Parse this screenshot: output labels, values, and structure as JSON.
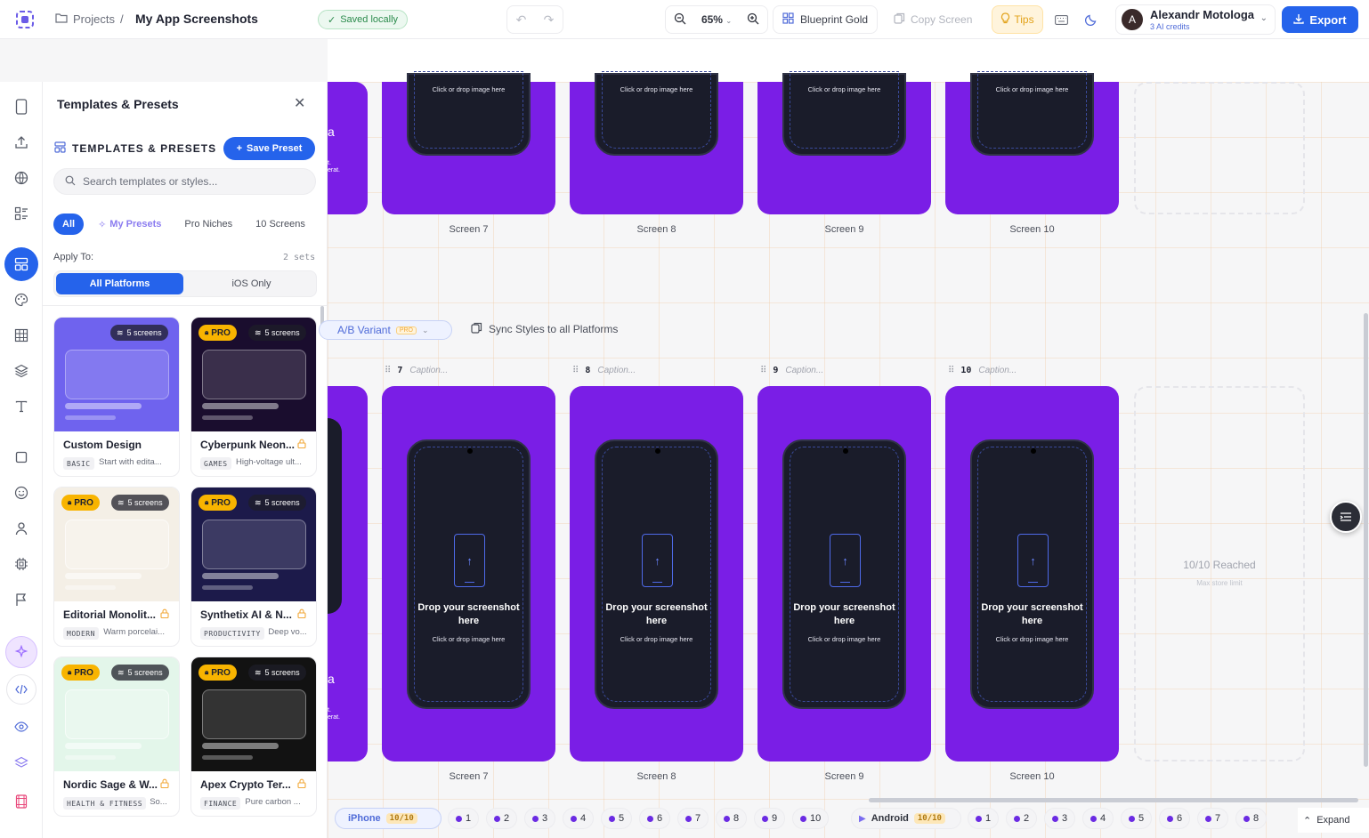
{
  "topbar": {
    "breadcrumb_root": "Projects",
    "breadcrumb_sep": "/",
    "project_title": "My App Screenshots",
    "saved_status": "Saved locally",
    "zoom": "65%",
    "theme_name": "Blueprint Gold",
    "copy_screen": "Copy Screen",
    "tips": "Tips",
    "user_name": "Alexandr Motologa",
    "user_credits": "3 AI credits",
    "user_initial": "A",
    "export": "Export"
  },
  "panel": {
    "title": "Templates & Presets",
    "section_title": "TEMPLATES & PRESETS",
    "save_preset": "Save Preset",
    "search_placeholder": "Search templates or styles...",
    "filters": [
      "All",
      "My Presets",
      "Pro Niches",
      "10 Screens"
    ],
    "apply_label": "Apply To:",
    "apply_count": "2 sets",
    "segment_a": "All Platforms",
    "segment_b": "iOS Only",
    "cards": [
      {
        "name": "Custom Design",
        "tag": "BASIC",
        "desc": "Start with edita...",
        "screens": "5 screens",
        "pro": false,
        "locked": false,
        "bg": "#6f63ee"
      },
      {
        "name": "Cyberpunk Neon...",
        "tag": "GAMES",
        "desc": "High-voltage ult...",
        "screens": "5 screens",
        "pro": true,
        "locked": true,
        "bg": "#1a0d2e"
      },
      {
        "name": "Editorial Monolit...",
        "tag": "MODERN",
        "desc": "Warm porcelai...",
        "screens": "5 screens",
        "pro": true,
        "locked": true,
        "bg": "#f4efe6"
      },
      {
        "name": "Synthetix AI & N...",
        "tag": "PRODUCTIVITY",
        "desc": "Deep vo...",
        "screens": "5 screens",
        "pro": true,
        "locked": true,
        "bg": "#1c1a4a"
      },
      {
        "name": "Nordic Sage & W...",
        "tag": "HEALTH & FITNESS",
        "desc": "So...",
        "screens": "5 screens",
        "pro": true,
        "locked": true,
        "bg": "#e3f6ea"
      },
      {
        "name": "Apex Crypto Ter...",
        "tag": "FINANCE",
        "desc": "Pure carbon ...",
        "screens": "5 screens",
        "pro": true,
        "locked": true,
        "bg": "#121212"
      }
    ],
    "pro_label": "PRO"
  },
  "canvas": {
    "screens_top": [
      "Screen 7",
      "Screen 8",
      "Screen 9",
      "Screen 10"
    ],
    "screens_bottom": [
      "Screen 7",
      "Screen 8",
      "Screen 9",
      "Screen 10"
    ],
    "caption_numbers": [
      "7",
      "8",
      "9",
      "10"
    ],
    "caption_placeholder": "Caption...",
    "drop_title": "Drop your screenshot here",
    "drop_sub": "Click or drop image here",
    "ab_variant": "A/B Variant",
    "ab_pro": "PRO",
    "sync_styles": "Sync Styles to all Platforms",
    "reached": "10/10 Reached",
    "reached_sub": "Max store limit",
    "side_letter": "a",
    "side_text_1": "t.",
    "side_text_2": "erat."
  },
  "bottombar": {
    "ios_label": "iPhone",
    "ios_count": "10/10",
    "ios_screens": [
      "1",
      "2",
      "3",
      "4",
      "5",
      "6",
      "7",
      "8",
      "9",
      "10"
    ],
    "android_label": "Android",
    "android_count": "10/10",
    "android_screens": [
      "1",
      "2",
      "3",
      "4",
      "5",
      "6",
      "7",
      "8"
    ],
    "expand": "Expand"
  },
  "colors": {
    "accent": "#2563eb",
    "frame_purple": "#7a1ee6",
    "phone_dark": "#1a1c2a",
    "pro_gold": "#f8b400"
  }
}
